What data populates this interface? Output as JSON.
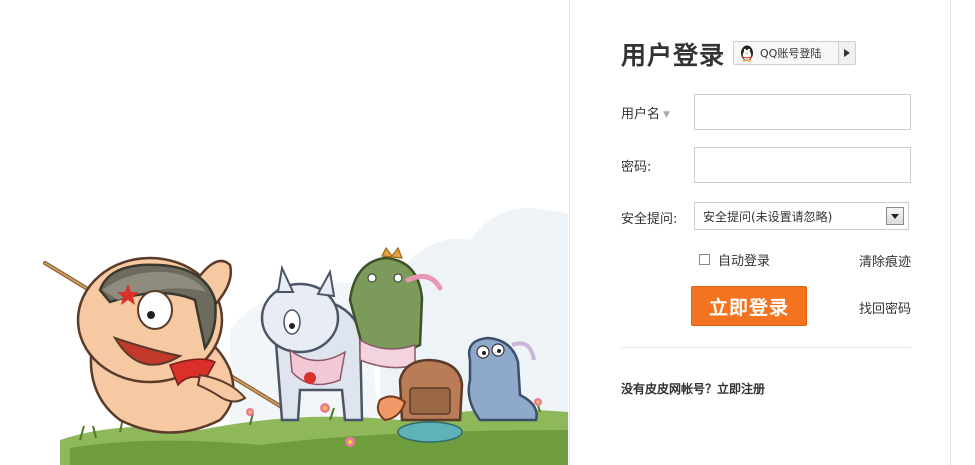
{
  "login": {
    "title": "用户登录",
    "qq_login_label": "QQ账号登陆",
    "username_label": "用户名",
    "username_value": "",
    "password_label": "密码:",
    "password_value": "",
    "security_label": "安全提问:",
    "security_selected": "安全提问(未设置请忽略)",
    "remember_label": "自动登录",
    "clear_traces": "清除痕迹",
    "submit_label": "立即登录",
    "find_password": "找回密码",
    "register_text": "没有皮皮网帐号？立即注册"
  },
  "colors": {
    "accent": "#f4731f",
    "text": "#333333",
    "border": "#cccccc"
  },
  "icons": {
    "qq": "qq-penguin-icon",
    "qq_arrow": "triangle-right-icon",
    "select_arrow": "triangle-down-icon",
    "username_caret": "caret-down-icon"
  }
}
